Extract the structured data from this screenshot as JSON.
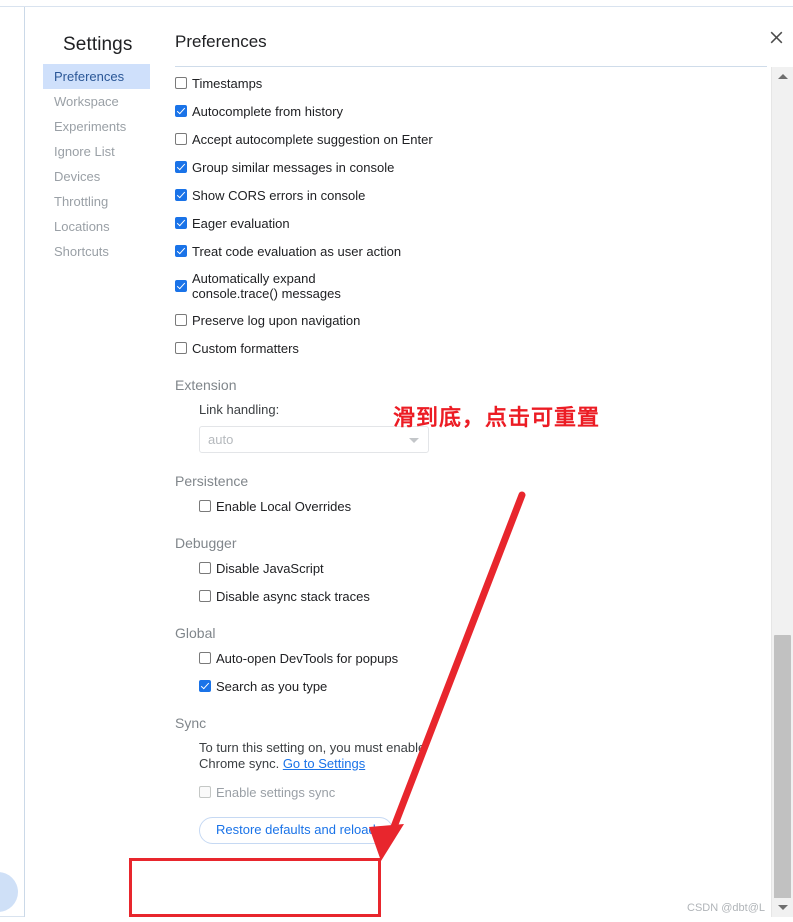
{
  "window": {
    "close_icon": "close-icon"
  },
  "sidebar": {
    "title": "Settings",
    "items": [
      {
        "label": "Preferences",
        "selected": true
      },
      {
        "label": "Workspace",
        "selected": false
      },
      {
        "label": "Experiments",
        "selected": false
      },
      {
        "label": "Ignore List",
        "selected": false
      },
      {
        "label": "Devices",
        "selected": false
      },
      {
        "label": "Throttling",
        "selected": false
      },
      {
        "label": "Locations",
        "selected": false
      },
      {
        "label": "Shortcuts",
        "selected": false
      }
    ]
  },
  "content": {
    "title": "Preferences",
    "console_options": [
      {
        "label": "Timestamps",
        "checked": false
      },
      {
        "label": "Autocomplete from history",
        "checked": true
      },
      {
        "label": "Accept autocomplete suggestion on Enter",
        "checked": false
      },
      {
        "label": "Group similar messages in console",
        "checked": true
      },
      {
        "label": "Show CORS errors in console",
        "checked": true
      },
      {
        "label": "Eager evaluation",
        "checked": true
      },
      {
        "label": "Treat code evaluation as user action",
        "checked": true
      },
      {
        "label": "Automatically expand console.trace() messages",
        "checked": true,
        "two_line": true
      },
      {
        "label": "Preserve log upon navigation",
        "checked": false
      },
      {
        "label": "Custom formatters",
        "checked": false
      }
    ],
    "extension": {
      "heading": "Extension",
      "link_handling_label": "Link handling:",
      "link_handling_value": "auto"
    },
    "persistence": {
      "heading": "Persistence",
      "options": [
        {
          "label": "Enable Local Overrides",
          "checked": false
        }
      ]
    },
    "debugger": {
      "heading": "Debugger",
      "options": [
        {
          "label": "Disable JavaScript",
          "checked": false
        },
        {
          "label": "Disable async stack traces",
          "checked": false
        }
      ]
    },
    "global": {
      "heading": "Global",
      "options": [
        {
          "label": "Auto-open DevTools for popups",
          "checked": false
        },
        {
          "label": "Search as you type",
          "checked": true
        }
      ]
    },
    "sync": {
      "heading": "Sync",
      "note_text": "To turn this setting on, you must enable Chrome sync. ",
      "note_link": "Go to Settings",
      "options": [
        {
          "label": "Enable settings sync",
          "checked": false,
          "disabled": true
        }
      ]
    },
    "restore_button": "Restore defaults and reload"
  },
  "scrollbar": {
    "up_icon": "caret-up-icon",
    "down_icon": "caret-down-icon"
  },
  "annotations": {
    "note": "滑到底，点击可重置",
    "arrow_color": "#e8262d",
    "highlight_color": "#e8262d"
  },
  "watermark": "CSDN @dbt@L"
}
